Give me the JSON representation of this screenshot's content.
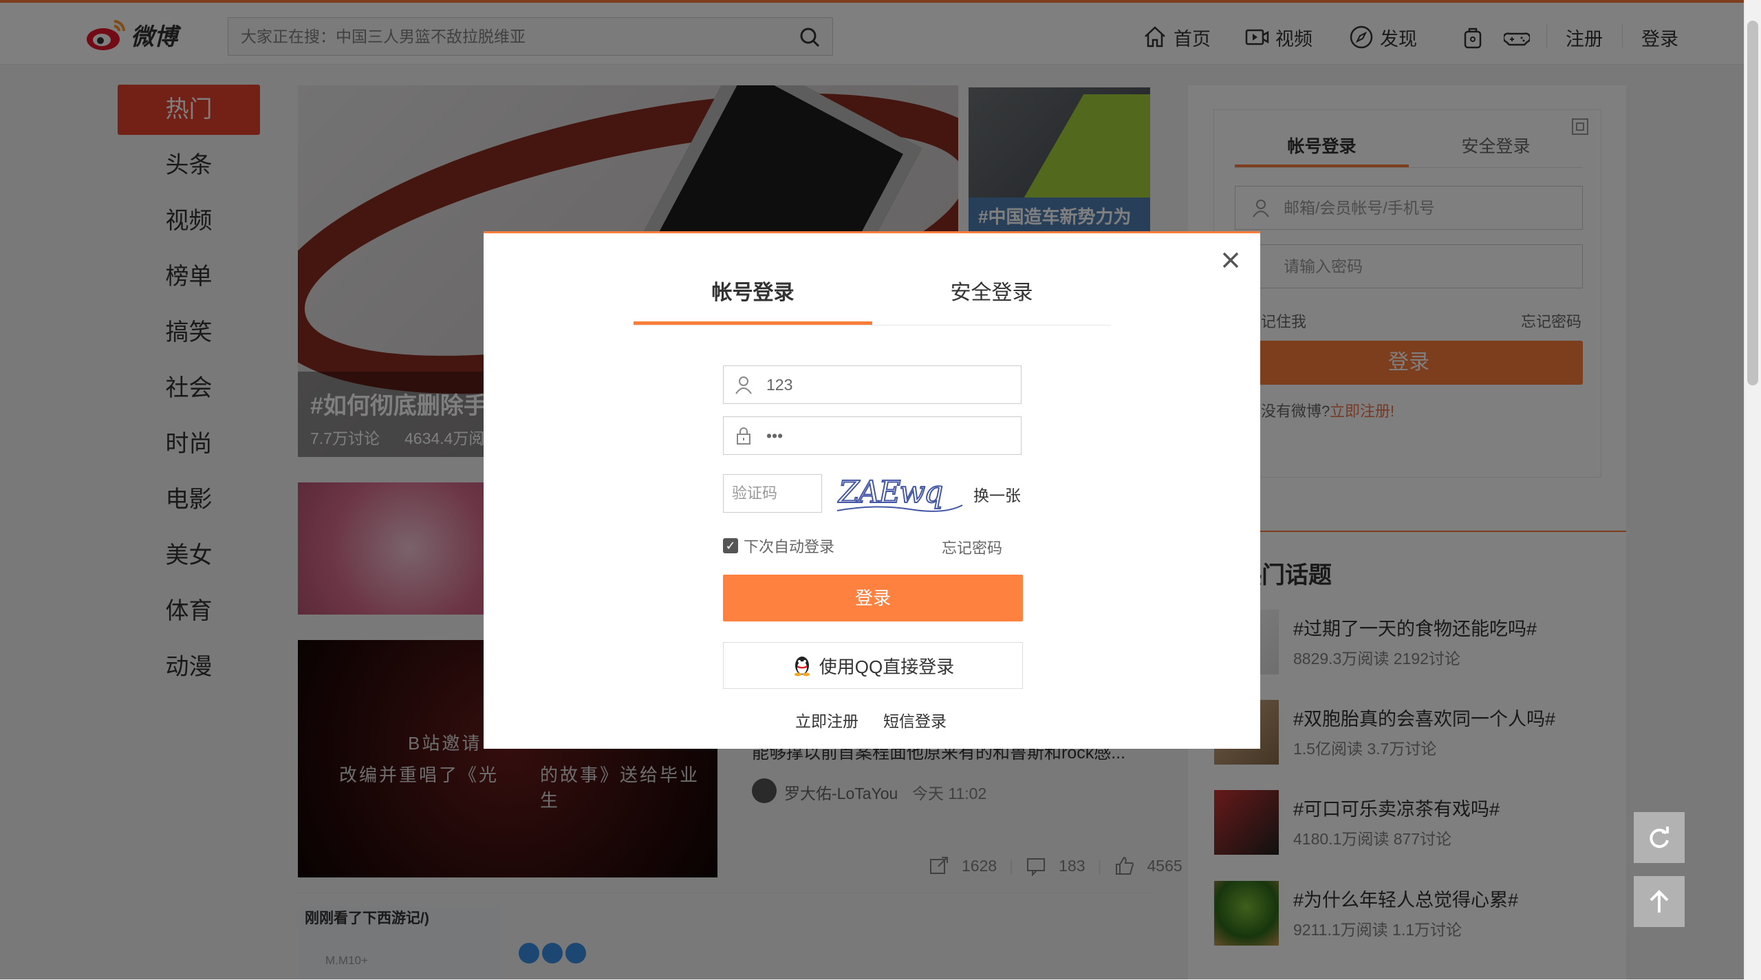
{
  "header": {
    "logo_text": "微博",
    "search_placeholder": "大家正在搜：中国三人男篮不敌拉脱维亚",
    "nav": {
      "home": "首页",
      "video": "视频",
      "discover": "发现",
      "register": "注册",
      "login": "登录"
    }
  },
  "sidebar": {
    "items": [
      {
        "label": "热门",
        "active": true
      },
      {
        "label": "头条"
      },
      {
        "label": "视频"
      },
      {
        "label": "榜单"
      },
      {
        "label": "搞笑"
      },
      {
        "label": "社会"
      },
      {
        "label": "时尚"
      },
      {
        "label": "电影"
      },
      {
        "label": "美女"
      },
      {
        "label": "体育"
      },
      {
        "label": "动漫"
      }
    ]
  },
  "feed": {
    "big_card": {
      "title": "#如何彻底删除手",
      "discuss": "7.7万讨论",
      "reads": "4634.4万阅"
    },
    "side_card_title": "#中国造车新势力为",
    "video_card": {
      "caption_line1": "B站邀请",
      "caption_line2": "改编并重唱了《光",
      "caption_line2b": "的故事》送给毕业生",
      "desc": "能够撑以前首案程面他原来有的和鲁斯和rock感...",
      "author": "罗大佑-LoTaYou",
      "time": "今天 11:02",
      "shares": "1628",
      "comments": "183",
      "likes": "4565"
    },
    "bottom_card_title": "刚刚看了下西游记/)",
    "bottom_card_meta": "M.M10+"
  },
  "right_login": {
    "tab_account": "帐号登录",
    "tab_secure": "安全登录",
    "username_placeholder": "邮箱/会员帐号/手机号",
    "password_placeholder": "请输入密码",
    "remember": "记住我",
    "forgot": "忘记密码",
    "login_btn": "登录",
    "no_account": "没有微博?",
    "register_now": "立即注册!"
  },
  "hot_topics": {
    "title": "热门话题",
    "items": [
      {
        "title": "#过期了一天的食物还能吃吗#",
        "meta": "8829.3万阅读 2192讨论"
      },
      {
        "title": "#双胞胎真的会喜欢同一个人吗#",
        "meta": "1.5亿阅读 3.7万讨论"
      },
      {
        "title": "#可口可乐卖凉茶有戏吗#",
        "meta": "4180.1万阅读 877讨论"
      },
      {
        "title": "#为什么年轻人总觉得心累#",
        "meta": "9211.1万阅读 1.1万讨论"
      }
    ]
  },
  "modal": {
    "tab_account": "帐号登录",
    "tab_secure": "安全登录",
    "username_value": "123",
    "password_value": "•••",
    "captcha_placeholder": "验证码",
    "captcha_text": "ZAEwq",
    "captcha_refresh": "换一张",
    "auto_login": "下次自动登录",
    "forgot": "忘记密码",
    "login_btn": "登录",
    "qq_login": "使用QQ直接登录",
    "register": "立即注册",
    "sms_login": "短信登录"
  },
  "colors": {
    "accent": "#fa7d3c",
    "active_side": "#e6412e",
    "overlay": "rgba(0,0,0,0.5)"
  }
}
